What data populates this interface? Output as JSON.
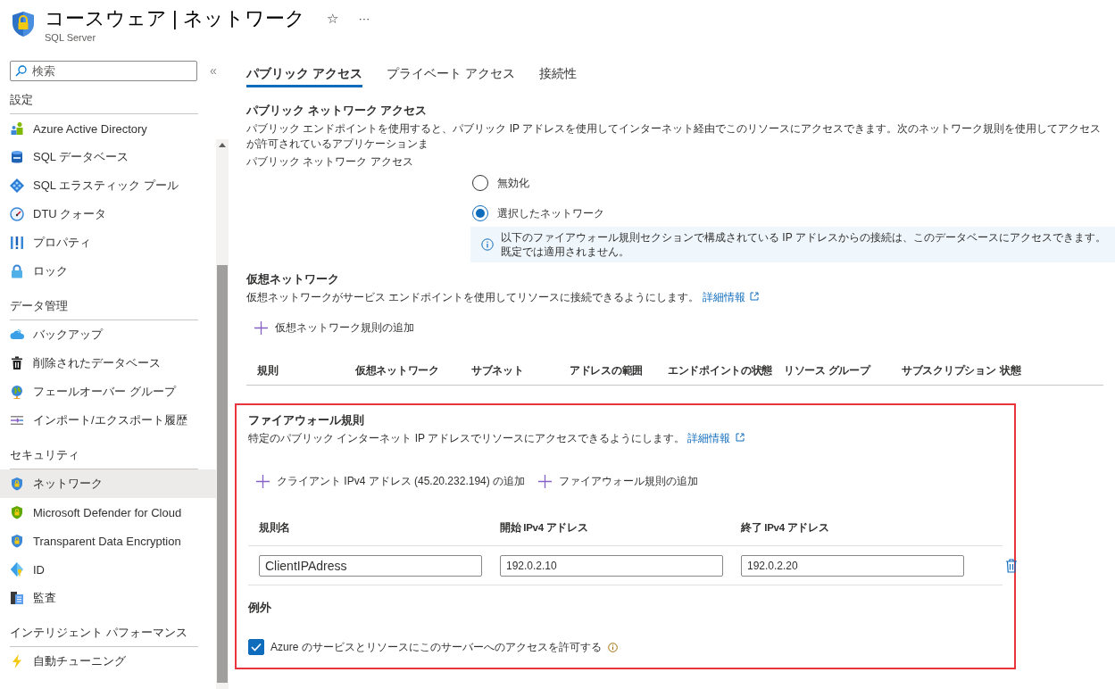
{
  "header": {
    "title": "コースウェア | ネットワーク",
    "subtitle": "SQL Server",
    "favorite": "☆",
    "more": "···"
  },
  "sidebar": {
    "search": {
      "placeholder": "検索"
    },
    "collapse": "«",
    "groups": [
      {
        "title": "設定",
        "items": [
          {
            "label": "Azure Active Directory",
            "selected": false
          },
          {
            "label": "SQL データベース",
            "selected": false
          },
          {
            "label": "SQL エラスティック プール",
            "selected": false
          },
          {
            "label": "DTU クォータ",
            "selected": false
          },
          {
            "label": "プロパティ",
            "selected": false
          },
          {
            "label": "ロック",
            "selected": false
          }
        ]
      },
      {
        "title": "データ管理",
        "items": [
          {
            "label": "バックアップ",
            "selected": false
          },
          {
            "label": "削除されたデータベース",
            "selected": false
          },
          {
            "label": "フェールオーバー グループ",
            "selected": false
          },
          {
            "label": "インポート/エクスポート履歴",
            "selected": false
          }
        ]
      },
      {
        "title": "セキュリティ",
        "items": [
          {
            "label": "ネットワーク",
            "selected": true
          },
          {
            "label": "Microsoft Defender for Cloud",
            "selected": false
          },
          {
            "label": "Transparent Data Encryption",
            "selected": false
          },
          {
            "label": "ID",
            "selected": false
          },
          {
            "label": "監査",
            "selected": false
          }
        ]
      },
      {
        "title": "インテリジェント パフォーマンス",
        "items": [
          {
            "label": "自動チューニング",
            "selected": false
          }
        ]
      }
    ]
  },
  "tabs": [
    {
      "label": "パブリック アクセス",
      "selected": true
    },
    {
      "label": "プライベート アクセス",
      "selected": false
    },
    {
      "label": "接続性",
      "selected": false
    }
  ],
  "public_access": {
    "title": "パブリック ネットワーク アクセス",
    "description": "パブリック エンドポイントを使用すると、パブリック IP アドレスを使用してインターネット経由でこのリソースにアクセスできます。次のネットワーク規則を使用してアクセスが許可されているアプリケーションま",
    "field_label": "パブリック ネットワーク アクセス",
    "options": [
      {
        "label": "無効化",
        "selected": false
      },
      {
        "label": "選択したネットワーク",
        "selected": true
      }
    ],
    "info": "以下のファイアウォール規則セクションで構成されている IP アドレスからの接続は、このデータベースにアクセスできます。既定では適用されません。"
  },
  "virtual_network": {
    "title": "仮想ネットワーク",
    "description": "仮想ネットワークがサービス エンドポイントを使用してリソースに接続できるようにします。",
    "link": "詳細情報",
    "add_button": "仮想ネットワーク規則の追加",
    "columns": [
      "規則",
      "仮想ネットワーク",
      "サブネット",
      "アドレスの範囲",
      "エンドポイントの状態",
      "リソース グループ",
      "サブスクリプション",
      "状態"
    ]
  },
  "firewall": {
    "title": "ファイアウォール規則",
    "description": "特定のパブリック インターネット IP アドレスでリソースにアクセスできるようにします。",
    "link": "詳細情報",
    "actions": [
      "クライアント IPv4 アドレス (45.20.232.194) の追加",
      "ファイアウォール規則の追加"
    ],
    "columns": [
      "規則名",
      "開始 IPv4 アドレス",
      "終了 IPv4 アドレス"
    ],
    "rows": [
      {
        "rule_name": "ClientIPAdress",
        "start_ip": "192.0.2.10",
        "end_ip": "192.0.2.20"
      }
    ],
    "exceptions_title": "例外",
    "exception": {
      "label": "Azure のサービスとリソースにこのサーバーへのアクセスを許可する",
      "checked": true
    }
  }
}
